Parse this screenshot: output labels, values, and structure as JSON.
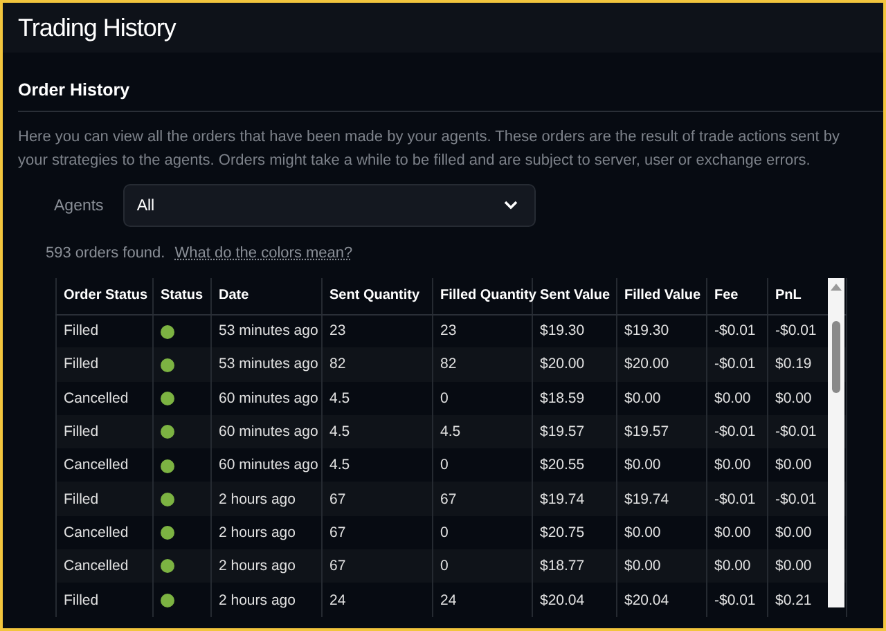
{
  "header": {
    "title": "Trading History"
  },
  "section": {
    "title": "Order History",
    "description": "Here you can view all the orders that have been made by your agents. These orders are the result of trade actions sent by your strategies to the agents. Orders might take a while to be filled and are subject to server, user or exchange errors."
  },
  "filter": {
    "label": "Agents",
    "value": "All"
  },
  "summary": {
    "count": "593 orders found.",
    "link": "What do the colors mean?"
  },
  "table": {
    "columns": [
      "Order Status",
      "Status",
      "Date",
      "Sent Quantity",
      "Filled Quantity",
      "Sent Value",
      "Filled Value",
      "Fee",
      "PnL"
    ],
    "rows": [
      {
        "order_status": "Filled",
        "color": "#7cb342",
        "date": "53 minutes ago",
        "sent_quantity": "23",
        "filled_quantity": "23",
        "sent_value": "$19.30",
        "filled_value": "$19.30",
        "fee": "-$0.01",
        "pnl": "-$0.01"
      },
      {
        "order_status": "Filled",
        "color": "#7cb342",
        "date": "53 minutes ago",
        "sent_quantity": "82",
        "filled_quantity": "82",
        "sent_value": "$20.00",
        "filled_value": "$20.00",
        "fee": "-$0.01",
        "pnl": "$0.19"
      },
      {
        "order_status": "Cancelled",
        "color": "#7cb342",
        "date": "60 minutes ago",
        "sent_quantity": "4.5",
        "filled_quantity": "0",
        "sent_value": "$18.59",
        "filled_value": "$0.00",
        "fee": "$0.00",
        "pnl": "$0.00"
      },
      {
        "order_status": "Filled",
        "color": "#7cb342",
        "date": "60 minutes ago",
        "sent_quantity": "4.5",
        "filled_quantity": "4.5",
        "sent_value": "$19.57",
        "filled_value": "$19.57",
        "fee": "-$0.01",
        "pnl": "-$0.01"
      },
      {
        "order_status": "Cancelled",
        "color": "#7cb342",
        "date": "60 minutes ago",
        "sent_quantity": "4.5",
        "filled_quantity": "0",
        "sent_value": "$20.55",
        "filled_value": "$0.00",
        "fee": "$0.00",
        "pnl": "$0.00"
      },
      {
        "order_status": "Filled",
        "color": "#7cb342",
        "date": "2 hours ago",
        "sent_quantity": "67",
        "filled_quantity": "67",
        "sent_value": "$19.74",
        "filled_value": "$19.74",
        "fee": "-$0.01",
        "pnl": "-$0.01"
      },
      {
        "order_status": "Cancelled",
        "color": "#7cb342",
        "date": "2 hours ago",
        "sent_quantity": "67",
        "filled_quantity": "0",
        "sent_value": "$20.75",
        "filled_value": "$0.00",
        "fee": "$0.00",
        "pnl": "$0.00"
      },
      {
        "order_status": "Cancelled",
        "color": "#7cb342",
        "date": "2 hours ago",
        "sent_quantity": "67",
        "filled_quantity": "0",
        "sent_value": "$18.77",
        "filled_value": "$0.00",
        "fee": "$0.00",
        "pnl": "$0.00"
      },
      {
        "order_status": "Filled",
        "color": "#7cb342",
        "date": "2 hours ago",
        "sent_quantity": "24",
        "filled_quantity": "24",
        "sent_value": "$20.04",
        "filled_value": "$20.04",
        "fee": "-$0.01",
        "pnl": "$0.21"
      }
    ]
  }
}
